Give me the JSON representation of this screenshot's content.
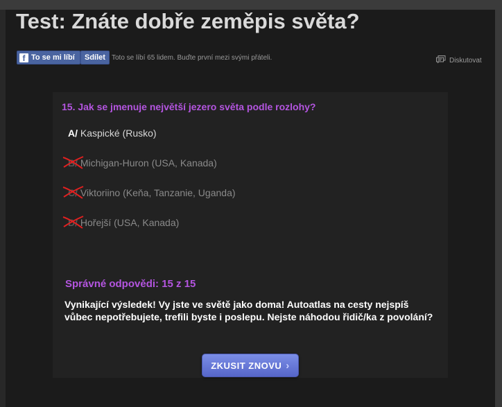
{
  "page": {
    "title": "Test: Znáte dobře zeměpis světa?"
  },
  "facebook": {
    "like_label": "To se mi líbí",
    "share_label": "Sdílet",
    "like_text": "Toto se líbí 65 lidem. Buďte první mezi svými přáteli."
  },
  "discuss": {
    "label": "Diskutovat"
  },
  "quiz": {
    "question": "15. Jak se jmenuje největší jezero světa podle rozlohy?",
    "answers": [
      {
        "letter": "A/",
        "text": "Kaspické (Rusko)",
        "status": "correct"
      },
      {
        "letter": "B/",
        "text": "Michigan-Huron (USA, Kanada)",
        "status": "wrong"
      },
      {
        "letter": "C/",
        "text": "Viktoriino (Keňa, Tanzanie, Uganda)",
        "status": "wrong"
      },
      {
        "letter": "D/",
        "text": "Hořejší (USA, Kanada)",
        "status": "wrong"
      }
    ]
  },
  "result": {
    "title": "Správné odpovědi: 15 z 15",
    "text": "Vynikající výsledek! Vy jste ve světě jako doma! Autoatlas na cesty nejspíš vůbec nepotřebujete, trefili byste i poslepu. Nejste náhodou řidič/ka z povolání?",
    "retry_label": "ZKUSIT ZNOVU"
  },
  "colors": {
    "accent": "#b455e0",
    "button": "#6678d8",
    "facebook": "#4a64a0",
    "cross": "#e02020"
  },
  "icons": {
    "facebook": "facebook-icon",
    "discuss": "comment-icon",
    "cross": "cross-mark-icon",
    "chevron": "chevron-right-icon"
  }
}
